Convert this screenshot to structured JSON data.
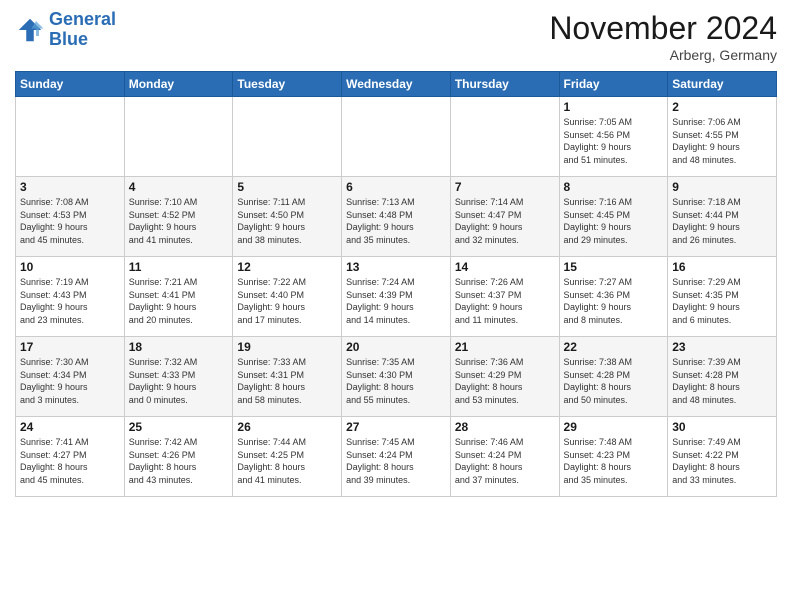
{
  "logo": {
    "line1": "General",
    "line2": "Blue"
  },
  "title": "November 2024",
  "location": "Arberg, Germany",
  "days_header": [
    "Sunday",
    "Monday",
    "Tuesday",
    "Wednesday",
    "Thursday",
    "Friday",
    "Saturday"
  ],
  "weeks": [
    [
      {
        "day": "",
        "info": ""
      },
      {
        "day": "",
        "info": ""
      },
      {
        "day": "",
        "info": ""
      },
      {
        "day": "",
        "info": ""
      },
      {
        "day": "",
        "info": ""
      },
      {
        "day": "1",
        "info": "Sunrise: 7:05 AM\nSunset: 4:56 PM\nDaylight: 9 hours\nand 51 minutes."
      },
      {
        "day": "2",
        "info": "Sunrise: 7:06 AM\nSunset: 4:55 PM\nDaylight: 9 hours\nand 48 minutes."
      }
    ],
    [
      {
        "day": "3",
        "info": "Sunrise: 7:08 AM\nSunset: 4:53 PM\nDaylight: 9 hours\nand 45 minutes."
      },
      {
        "day": "4",
        "info": "Sunrise: 7:10 AM\nSunset: 4:52 PM\nDaylight: 9 hours\nand 41 minutes."
      },
      {
        "day": "5",
        "info": "Sunrise: 7:11 AM\nSunset: 4:50 PM\nDaylight: 9 hours\nand 38 minutes."
      },
      {
        "day": "6",
        "info": "Sunrise: 7:13 AM\nSunset: 4:48 PM\nDaylight: 9 hours\nand 35 minutes."
      },
      {
        "day": "7",
        "info": "Sunrise: 7:14 AM\nSunset: 4:47 PM\nDaylight: 9 hours\nand 32 minutes."
      },
      {
        "day": "8",
        "info": "Sunrise: 7:16 AM\nSunset: 4:45 PM\nDaylight: 9 hours\nand 29 minutes."
      },
      {
        "day": "9",
        "info": "Sunrise: 7:18 AM\nSunset: 4:44 PM\nDaylight: 9 hours\nand 26 minutes."
      }
    ],
    [
      {
        "day": "10",
        "info": "Sunrise: 7:19 AM\nSunset: 4:43 PM\nDaylight: 9 hours\nand 23 minutes."
      },
      {
        "day": "11",
        "info": "Sunrise: 7:21 AM\nSunset: 4:41 PM\nDaylight: 9 hours\nand 20 minutes."
      },
      {
        "day": "12",
        "info": "Sunrise: 7:22 AM\nSunset: 4:40 PM\nDaylight: 9 hours\nand 17 minutes."
      },
      {
        "day": "13",
        "info": "Sunrise: 7:24 AM\nSunset: 4:39 PM\nDaylight: 9 hours\nand 14 minutes."
      },
      {
        "day": "14",
        "info": "Sunrise: 7:26 AM\nSunset: 4:37 PM\nDaylight: 9 hours\nand 11 minutes."
      },
      {
        "day": "15",
        "info": "Sunrise: 7:27 AM\nSunset: 4:36 PM\nDaylight: 9 hours\nand 8 minutes."
      },
      {
        "day": "16",
        "info": "Sunrise: 7:29 AM\nSunset: 4:35 PM\nDaylight: 9 hours\nand 6 minutes."
      }
    ],
    [
      {
        "day": "17",
        "info": "Sunrise: 7:30 AM\nSunset: 4:34 PM\nDaylight: 9 hours\nand 3 minutes."
      },
      {
        "day": "18",
        "info": "Sunrise: 7:32 AM\nSunset: 4:33 PM\nDaylight: 9 hours\nand 0 minutes."
      },
      {
        "day": "19",
        "info": "Sunrise: 7:33 AM\nSunset: 4:31 PM\nDaylight: 8 hours\nand 58 minutes."
      },
      {
        "day": "20",
        "info": "Sunrise: 7:35 AM\nSunset: 4:30 PM\nDaylight: 8 hours\nand 55 minutes."
      },
      {
        "day": "21",
        "info": "Sunrise: 7:36 AM\nSunset: 4:29 PM\nDaylight: 8 hours\nand 53 minutes."
      },
      {
        "day": "22",
        "info": "Sunrise: 7:38 AM\nSunset: 4:28 PM\nDaylight: 8 hours\nand 50 minutes."
      },
      {
        "day": "23",
        "info": "Sunrise: 7:39 AM\nSunset: 4:28 PM\nDaylight: 8 hours\nand 48 minutes."
      }
    ],
    [
      {
        "day": "24",
        "info": "Sunrise: 7:41 AM\nSunset: 4:27 PM\nDaylight: 8 hours\nand 45 minutes."
      },
      {
        "day": "25",
        "info": "Sunrise: 7:42 AM\nSunset: 4:26 PM\nDaylight: 8 hours\nand 43 minutes."
      },
      {
        "day": "26",
        "info": "Sunrise: 7:44 AM\nSunset: 4:25 PM\nDaylight: 8 hours\nand 41 minutes."
      },
      {
        "day": "27",
        "info": "Sunrise: 7:45 AM\nSunset: 4:24 PM\nDaylight: 8 hours\nand 39 minutes."
      },
      {
        "day": "28",
        "info": "Sunrise: 7:46 AM\nSunset: 4:24 PM\nDaylight: 8 hours\nand 37 minutes."
      },
      {
        "day": "29",
        "info": "Sunrise: 7:48 AM\nSunset: 4:23 PM\nDaylight: 8 hours\nand 35 minutes."
      },
      {
        "day": "30",
        "info": "Sunrise: 7:49 AM\nSunset: 4:22 PM\nDaylight: 8 hours\nand 33 minutes."
      }
    ]
  ]
}
